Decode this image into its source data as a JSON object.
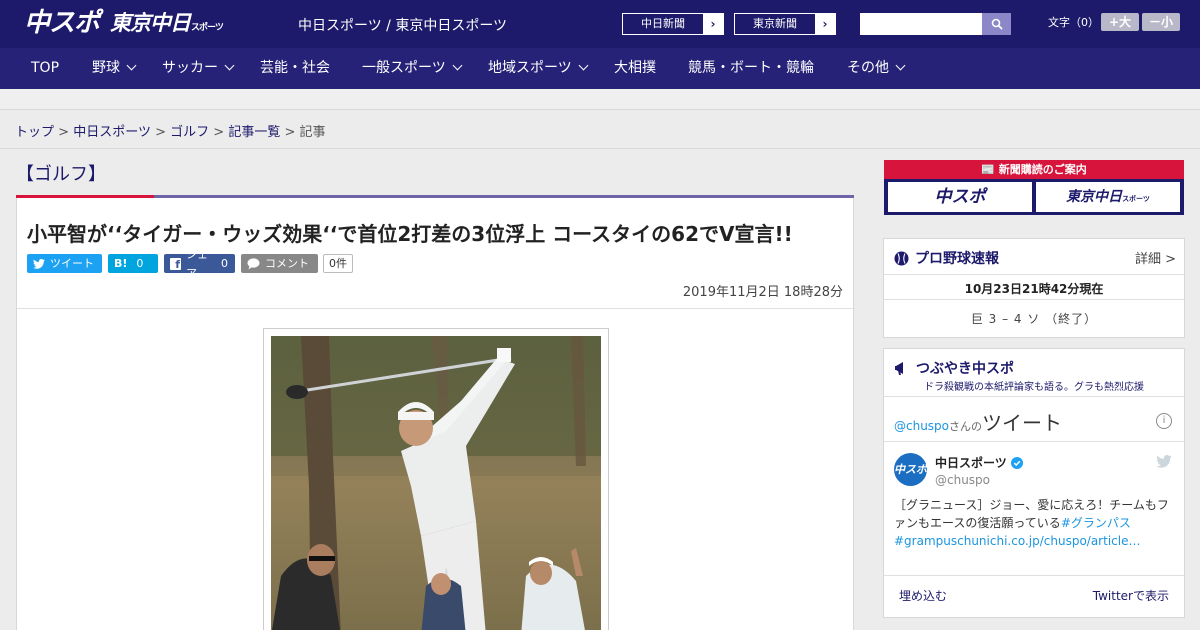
{
  "header": {
    "logo_chuspo": "中スポ",
    "logo_tokyo": "東京中日",
    "logo_tokyo_sub": "スポーツ",
    "site_name": "中日スポーツ / 東京中日スポーツ",
    "paper_links": [
      {
        "label": "中日新聞"
      },
      {
        "label": "東京新聞"
      }
    ],
    "search_placeholder": "",
    "font_size_label": "文字（0）",
    "font_bigger": "+大",
    "font_smaller": "－小"
  },
  "nav": {
    "items": [
      {
        "label": "TOP",
        "has_menu": false
      },
      {
        "label": "野球",
        "has_menu": true
      },
      {
        "label": "サッカー",
        "has_menu": true
      },
      {
        "label": "芸能・社会",
        "has_menu": false
      },
      {
        "label": "一般スポーツ",
        "has_menu": true
      },
      {
        "label": "地域スポーツ",
        "has_menu": true
      },
      {
        "label": "大相撲",
        "has_menu": false
      },
      {
        "label": "競馬・ボート・競輪",
        "has_menu": false
      },
      {
        "label": "その他",
        "has_menu": true
      }
    ]
  },
  "breadcrumb": {
    "items": [
      "トップ",
      "中日スポーツ",
      "ゴルフ",
      "記事一覧"
    ],
    "current": "記事",
    "separator": ">"
  },
  "article": {
    "category": "【ゴルフ】",
    "headline": "小平智が‘‘タイガー・ウッズ効果‘‘で首位2打差の3位浮上 コースタイの62でV宣言!!",
    "share": {
      "tweet_label": "ツイート",
      "hatena_label": "B!",
      "hatena_count": "0",
      "facebook_label": "シェア",
      "facebook_count": "0",
      "comment_label": "コメント",
      "comment_count": "0件"
    },
    "date": "2019年11月2日 18時28分"
  },
  "sidebar": {
    "subscribe": {
      "title": "新聞購読のご案内",
      "chuspo": "中スポ",
      "tokyo": "東京中日",
      "tokyo_sub": "スポーツ"
    },
    "baseball": {
      "title": "プロ野球速報",
      "detail": "詳細 >",
      "time": "10月23日21時42分現在",
      "score": "巨 3 – 4 ソ （終了）"
    },
    "tweets": {
      "title": "つぶやき中スポ",
      "subtitle": "ドラ殺観戦の本紙評論家も語る。グラも熱烈応援",
      "handle": "@chuspo",
      "handle_suffix": "さんの",
      "heading": "ツイート",
      "user_name": "中日スポーツ",
      "user_at": "@chuspo",
      "avatar_text": "中スポ",
      "text": "［グラニュース］ジョー、愛に応えろ！チームもファンもエースの復活願っている",
      "hashtag": "#グランパス",
      "link": "#grampuschunichi.co.jp/chuspo/article…",
      "embed": "埋め込む",
      "view_on": "Twitterで表示"
    }
  },
  "colors": {
    "brand_navy": "#1d1a6b",
    "nav_bg": "#262277",
    "accent_red": "#d6143c",
    "twitter_blue": "#1da1f2"
  }
}
